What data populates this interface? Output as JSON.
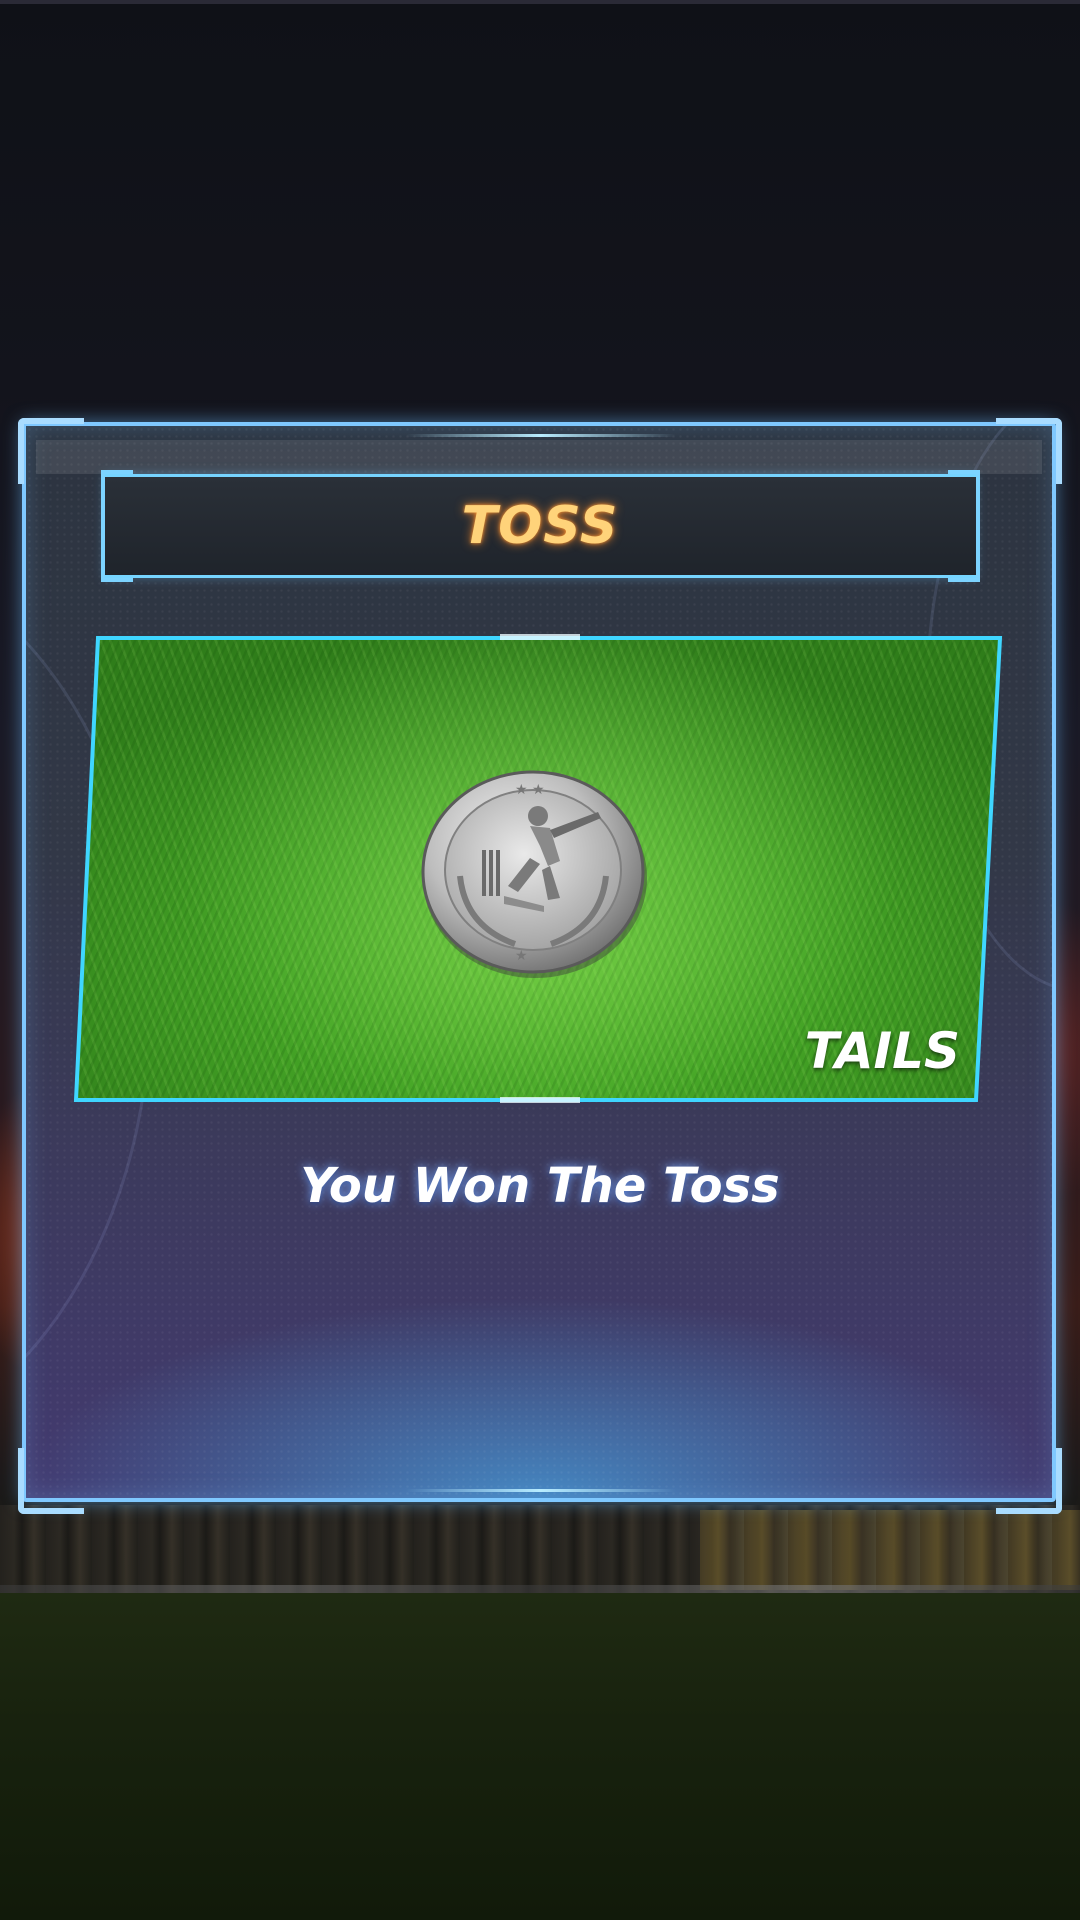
{
  "dialog": {
    "title": "TOSS",
    "coin_side_label": "TAILS",
    "result_message": "You Won The Toss"
  },
  "icons": {
    "coin": "cricket-batsman-coin-icon"
  },
  "colors": {
    "title_text": "#ffd37a",
    "panel_border": "#7fc8ff",
    "image_border": "#3fd6ff",
    "result_text": "#ffffff"
  }
}
